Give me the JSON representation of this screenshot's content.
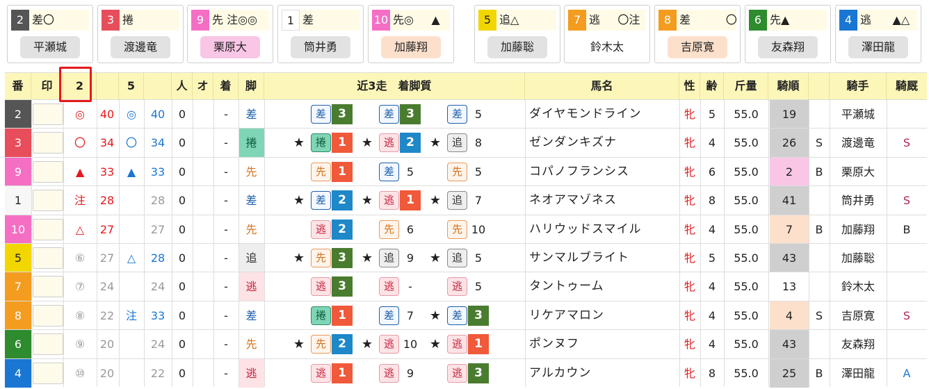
{
  "cards": [
    {
      "num": "2",
      "mark": "差〇",
      "jockey": "平瀬城",
      "numBg": "#555555",
      "numColor": "#ffffff",
      "jockeyBg": "#e2e2e2"
    },
    {
      "num": "3",
      "mark": "捲",
      "jockey": "渡邊竜",
      "numBg": "#e84d5b",
      "numColor": "#ffffff",
      "jockeyBg": "#e2e2e2"
    },
    {
      "num": "9",
      "mark": "先 注◎◎",
      "jockey": "栗原大",
      "numBg": "#f46fc4",
      "numColor": "#ffffff",
      "jockeyBg": "#f9c6e6"
    },
    {
      "num": "1",
      "mark": "差",
      "jockey": "筒井勇",
      "numBg": "#ffffff",
      "numColor": "#222222",
      "jockeyBg": "#e2e2e2"
    },
    {
      "num": "10",
      "mark": "先◎     ▲",
      "jockey": "加藤翔",
      "numBg": "#f46fc4",
      "numColor": "#ffffff",
      "jockeyBg": "#fde0cc"
    },
    {
      "num": "5",
      "mark": "追△",
      "jockey": "加藤聡",
      "numBg": "#f2d600",
      "numColor": "#222222",
      "jockeyBg": "#e2e2e2"
    },
    {
      "num": "7",
      "mark": "逃     〇注",
      "jockey": "鈴木太",
      "numBg": "#f39c1f",
      "numColor": "#ffffff",
      "jockeyBg": "transparent"
    },
    {
      "num": "8",
      "mark": "差          〇",
      "jockey": "吉原寛",
      "numBg": "#f39c1f",
      "numColor": "#ffffff",
      "jockeyBg": "#fde0cc"
    },
    {
      "num": "6",
      "mark": "先▲",
      "jockey": "友森翔",
      "numBg": "#2e8b2e",
      "numColor": "#ffffff",
      "jockeyBg": "#e2e2e2"
    },
    {
      "num": "4",
      "mark": "逃      ▲△",
      "jockey": "澤田龍",
      "numBg": "#1976d2",
      "numColor": "#ffffff",
      "jockeyBg": "#e2e2e2"
    }
  ],
  "header": {
    "ban": "番",
    "shirushi": "印",
    "c2": "2",
    "c5": "5",
    "nin": "人",
    "o": "オ",
    "chaku": "着",
    "ashi": "脚",
    "recent": "近3走　着脚質",
    "horse": "馬名",
    "sex": "性",
    "age": "齢",
    "weight": "斤量",
    "kijun": "騎順",
    "jockey": "騎手",
    "kibo": "騎厩"
  },
  "rows": [
    {
      "ban": "2",
      "banBg": "#555555",
      "banColor": "#ffffff",
      "m1": "◎",
      "m1c": "#e5191c",
      "v1": "40",
      "v1c": "#e5191c",
      "m2": "◎",
      "m2c": "#1976d2",
      "v2": "40",
      "v2c": "#1976d2",
      "nin": "0",
      "o": "",
      "chaku": "-",
      "ashi": "差",
      "ashiStyle": "sa",
      "runs": [
        {
          "star": "",
          "s": "差",
          "st": "sa",
          "p": "3",
          "pb": "#4a7c2f"
        },
        {
          "star": "",
          "s": "差",
          "st": "sa",
          "p": "3",
          "pb": "#4a7c2f"
        },
        {
          "star": "",
          "s": "差",
          "st": "sa",
          "p": "5",
          "pb": ""
        }
      ],
      "horse": "ダイヤモンドライン",
      "sex": "牝",
      "age": "5",
      "weight": "55.0",
      "kijun": "19",
      "kijunBg": "#cfcfcf",
      "kb": "",
      "jockey": "平瀬城",
      "kibo": "",
      "kiboC": "#222"
    },
    {
      "ban": "3",
      "banBg": "#e84d5b",
      "banColor": "#ffffff",
      "m1": "〇",
      "m1c": "#e5191c",
      "v1": "34",
      "v1c": "#e5191c",
      "m2": "〇",
      "m2c": "#1976d2",
      "v2": "34",
      "v2c": "#1976d2",
      "nin": "0",
      "o": "",
      "chaku": "-",
      "ashi": "捲",
      "ashiStyle": "maku",
      "runs": [
        {
          "star": "★",
          "s": "捲",
          "st": "maku",
          "p": "1",
          "pb": "#f0593a"
        },
        {
          "star": "★",
          "s": "逃",
          "st": "nige",
          "p": "2",
          "pb": "#1e88c8"
        },
        {
          "star": "★",
          "s": "追",
          "st": "oi",
          "p": "8",
          "pb": ""
        }
      ],
      "horse": "ゼンダンキズナ",
      "sex": "牝",
      "age": "4",
      "weight": "55.0",
      "kijun": "26",
      "kijunBg": "#cfcfcf",
      "kb": "S",
      "jockey": "渡邊竜",
      "kibo": "S",
      "kiboC": "#b0245a"
    },
    {
      "ban": "9",
      "banBg": "#f46fc4",
      "banColor": "#ffffff",
      "m1": "▲",
      "m1c": "#e5191c",
      "v1": "33",
      "v1c": "#e5191c",
      "m2": "▲",
      "m2c": "#1976d2",
      "v2": "33",
      "v2c": "#1976d2",
      "nin": "0",
      "o": "",
      "chaku": "-",
      "ashi": "先",
      "ashiStyle": "saki",
      "runs": [
        {
          "star": "",
          "s": "先",
          "st": "saki",
          "p": "1",
          "pb": "#f0593a"
        },
        {
          "star": "",
          "s": "差",
          "st": "sa",
          "p": "5",
          "pb": ""
        },
        {
          "star": "",
          "s": "先",
          "st": "saki",
          "p": "5",
          "pb": ""
        }
      ],
      "horse": "コパノフランシス",
      "sex": "牝",
      "age": "6",
      "weight": "55.0",
      "kijun": "2",
      "kijunBg": "#f9c6e6",
      "kb": "B",
      "jockey": "栗原大",
      "kibo": "",
      "kiboC": "#222"
    },
    {
      "ban": "1",
      "banBg": "#f7f7f7",
      "banColor": "#222222",
      "m1": "注",
      "m1c": "#e5191c",
      "v1": "28",
      "v1c": "#e5191c",
      "m2": "",
      "m2c": "#999",
      "v2": "28",
      "v2c": "#999999",
      "nin": "0",
      "o": "",
      "chaku": "-",
      "ashi": "差",
      "ashiStyle": "sa",
      "runs": [
        {
          "star": "★",
          "s": "差",
          "st": "sa",
          "p": "2",
          "pb": "#1e88c8"
        },
        {
          "star": "★",
          "s": "逃",
          "st": "nige",
          "p": "1",
          "pb": "#f0593a"
        },
        {
          "star": "★",
          "s": "追",
          "st": "oi",
          "p": "7",
          "pb": ""
        }
      ],
      "horse": "ネオアマゾネス",
      "sex": "牝",
      "age": "8",
      "weight": "55.0",
      "kijun": "41",
      "kijunBg": "#cfcfcf",
      "kb": "",
      "jockey": "筒井勇",
      "kibo": "S",
      "kiboC": "#b0245a"
    },
    {
      "ban": "10",
      "banBg": "#f46fc4",
      "banColor": "#ffffff",
      "m1": "△",
      "m1c": "#e5191c",
      "v1": "27",
      "v1c": "#e5191c",
      "m2": "",
      "m2c": "#999",
      "v2": "27",
      "v2c": "#999999",
      "nin": "0",
      "o": "",
      "chaku": "-",
      "ashi": "先",
      "ashiStyle": "saki",
      "runs": [
        {
          "star": "",
          "s": "逃",
          "st": "nige",
          "p": "2",
          "pb": "#1e88c8"
        },
        {
          "star": "",
          "s": "先",
          "st": "saki",
          "p": "6",
          "pb": ""
        },
        {
          "star": "",
          "s": "先",
          "st": "saki",
          "p": "10",
          "pb": ""
        }
      ],
      "horse": "ハリウッドスマイル",
      "sex": "牝",
      "age": "4",
      "weight": "55.0",
      "kijun": "7",
      "kijunBg": "#fde0cc",
      "kb": "B",
      "jockey": "加藤翔",
      "kibo": "B",
      "kiboC": "#222"
    },
    {
      "ban": "5",
      "banBg": "#f2d600",
      "banColor": "#222222",
      "m1": "⑥",
      "m1c": "#999999",
      "v1": "27",
      "v1c": "#999999",
      "m2": "△",
      "m2c": "#1976d2",
      "v2": "28",
      "v2c": "#1976d2",
      "nin": "0",
      "o": "",
      "chaku": "-",
      "ashi": "追",
      "ashiStyle": "oi",
      "runs": [
        {
          "star": "★",
          "s": "先",
          "st": "saki",
          "p": "3",
          "pb": "#4a7c2f"
        },
        {
          "star": "★",
          "s": "追",
          "st": "oi",
          "p": "9",
          "pb": ""
        },
        {
          "star": "★",
          "s": "追",
          "st": "oi",
          "p": "5",
          "pb": ""
        }
      ],
      "horse": "サンマルブライト",
      "sex": "牝",
      "age": "5",
      "weight": "55.0",
      "kijun": "43",
      "kijunBg": "#cfcfcf",
      "kb": "",
      "jockey": "加藤聡",
      "kibo": "",
      "kiboC": "#222"
    },
    {
      "ban": "7",
      "banBg": "#f39c1f",
      "banColor": "#ffffff",
      "m1": "⑦",
      "m1c": "#999999",
      "v1": "24",
      "v1c": "#999999",
      "m2": "",
      "m2c": "#999",
      "v2": "24",
      "v2c": "#999999",
      "nin": "0",
      "o": "",
      "chaku": "-",
      "ashi": "逃",
      "ashiStyle": "nige",
      "runs": [
        {
          "star": "",
          "s": "逃",
          "st": "nige",
          "p": "3",
          "pb": "#4a7c2f"
        },
        {
          "star": "",
          "s": "逃",
          "st": "nige",
          "p": "-",
          "pb": ""
        },
        {
          "star": "",
          "s": "逃",
          "st": "nige",
          "p": "5",
          "pb": ""
        }
      ],
      "horse": "タントゥーム",
      "sex": "牝",
      "age": "4",
      "weight": "55.0",
      "kijun": "13",
      "kijunBg": "transparent",
      "kb": "",
      "jockey": "鈴木太",
      "kibo": "",
      "kiboC": "#222"
    },
    {
      "ban": "8",
      "banBg": "#f39c1f",
      "banColor": "#ffffff",
      "m1": "⑧",
      "m1c": "#999999",
      "v1": "22",
      "v1c": "#999999",
      "m2": "注",
      "m2c": "#1976d2",
      "v2": "33",
      "v2c": "#1976d2",
      "nin": "0",
      "o": "",
      "chaku": "-",
      "ashi": "差",
      "ashiStyle": "sa",
      "runs": [
        {
          "star": "",
          "s": "捲",
          "st": "maku",
          "p": "1",
          "pb": "#f0593a"
        },
        {
          "star": "",
          "s": "差",
          "st": "sa",
          "p": "7",
          "pb": ""
        },
        {
          "star": "★",
          "s": "差",
          "st": "sa",
          "p": "3",
          "pb": "#4a7c2f"
        }
      ],
      "horse": "リケアマロン",
      "sex": "牝",
      "age": "4",
      "weight": "55.0",
      "kijun": "4",
      "kijunBg": "#fde0cc",
      "kb": "S",
      "jockey": "吉原寛",
      "kibo": "S",
      "kiboC": "#b0245a"
    },
    {
      "ban": "6",
      "banBg": "#2e8b2e",
      "banColor": "#ffffff",
      "m1": "⑨",
      "m1c": "#999999",
      "v1": "20",
      "v1c": "#999999",
      "m2": "",
      "m2c": "#999",
      "v2": "24",
      "v2c": "#999999",
      "nin": "0",
      "o": "",
      "chaku": "-",
      "ashi": "先",
      "ashiStyle": "saki",
      "runs": [
        {
          "star": "★",
          "s": "先",
          "st": "saki",
          "p": "2",
          "pb": "#1e88c8"
        },
        {
          "star": "★",
          "s": "逃",
          "st": "nige",
          "p": "10",
          "pb": ""
        },
        {
          "star": "★",
          "s": "逃",
          "st": "nige",
          "p": "1",
          "pb": "#f0593a"
        }
      ],
      "horse": "ポンヌフ",
      "sex": "牝",
      "age": "4",
      "weight": "55.0",
      "kijun": "43",
      "kijunBg": "#cfcfcf",
      "kb": "",
      "jockey": "友森翔",
      "kibo": "",
      "kiboC": "#222"
    },
    {
      "ban": "4",
      "banBg": "#1976d2",
      "banColor": "#ffffff",
      "m1": "⑩",
      "m1c": "#999999",
      "v1": "20",
      "v1c": "#999999",
      "m2": "",
      "m2c": "#999",
      "v2": "22",
      "v2c": "#999999",
      "nin": "0",
      "o": "",
      "chaku": "-",
      "ashi": "逃",
      "ashiStyle": "nige",
      "runs": [
        {
          "star": "",
          "s": "逃",
          "st": "nige",
          "p": "1",
          "pb": "#f0593a"
        },
        {
          "star": "",
          "s": "逃",
          "st": "nige",
          "p": "9",
          "pb": ""
        },
        {
          "star": "",
          "s": "逃",
          "st": "nige",
          "p": "3",
          "pb": "#4a7c2f"
        }
      ],
      "horse": "アルカウン",
      "sex": "牝",
      "age": "8",
      "weight": "55.0",
      "kijun": "25",
      "kijunBg": "#cfcfcf",
      "kb": "B",
      "jockey": "澤田龍",
      "kibo": "A",
      "kiboC": "#1976d2"
    }
  ],
  "styleColors": {
    "sa": {
      "c": "#1b5fa8",
      "b": "#1b5fa8",
      "bg": "#f3f7ff"
    },
    "maku": {
      "c": "#0a5a3a",
      "b": "#2a8a62",
      "bg": "#7fd6b6"
    },
    "saki": {
      "c": "#d4731a",
      "b": "#e59a5a",
      "bg": "#fff4ec"
    },
    "nige": {
      "c": "#c3203a",
      "b": "#e59aa6",
      "bg": "#fde3e6"
    },
    "oi": {
      "c": "#333333",
      "b": "#888888",
      "bg": "#eeeeee"
    }
  },
  "highlightColor": "#e5191c",
  "sexColor": "#e5191c"
}
